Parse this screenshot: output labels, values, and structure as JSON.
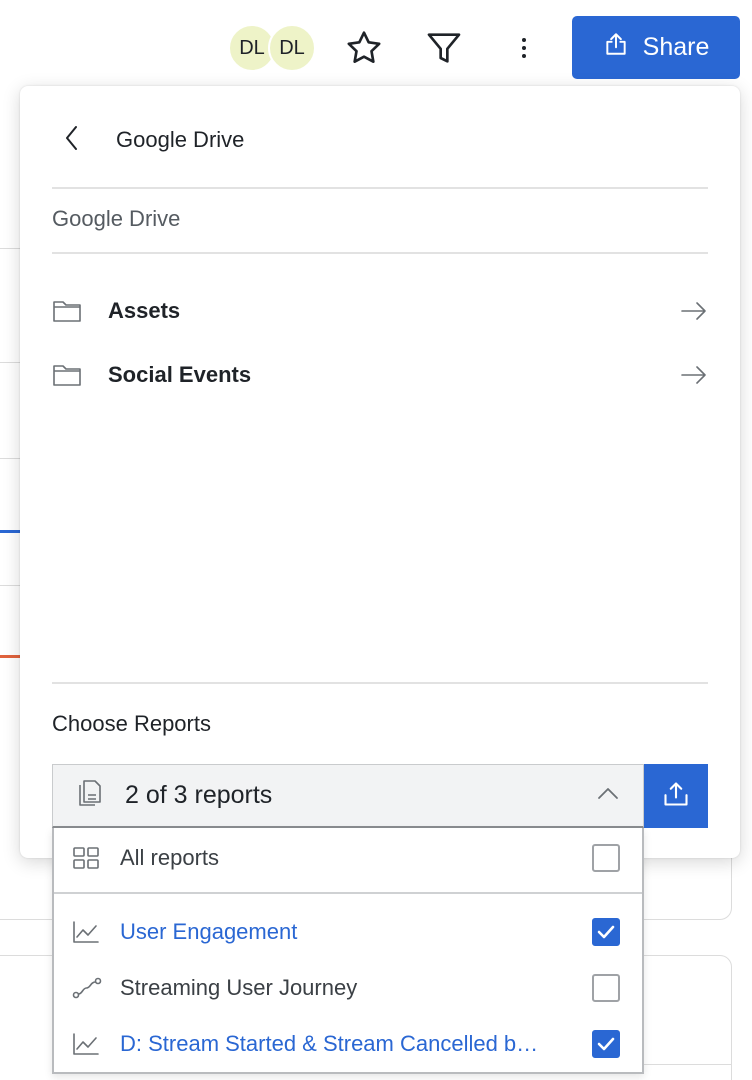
{
  "colors": {
    "accent": "#2a67d3",
    "avatar_bg": "#eef3c8",
    "chart_line_blue": "#2a67d3",
    "chart_line_orange": "#e0623d"
  },
  "toolbar": {
    "avatars": [
      "DL",
      "DL"
    ],
    "star_icon": "star-icon",
    "filter_icon": "filter-icon",
    "more_icon": "more-vertical-icon",
    "share_label": "Share",
    "share_icon": "share-upload-icon"
  },
  "popover": {
    "back_icon": "chevron-left-icon",
    "title": "Google Drive",
    "breadcrumb": "Google Drive",
    "folders": [
      {
        "name": "Assets",
        "icon": "folder-icon",
        "arrow_icon": "arrow-right-icon"
      },
      {
        "name": "Social Events",
        "icon": "folder-icon",
        "arrow_icon": "arrow-right-icon"
      }
    ],
    "choose_reports_label": "Choose Reports",
    "select": {
      "icon": "documents-icon",
      "value": "2 of 3 reports",
      "chevron_icon": "chevron-up-icon",
      "expanded": true
    },
    "export_icon": "upload-icon"
  },
  "dropdown": {
    "all": {
      "label": "All reports",
      "icon": "dashboard-grid-icon",
      "checked": false
    },
    "items": [
      {
        "label": "User Engagement",
        "icon": "line-chart-icon",
        "checked": true
      },
      {
        "label": "Streaming User Journey",
        "icon": "journey-icon",
        "checked": false
      },
      {
        "label": "D: Stream Started & Stream Cancelled b…",
        "icon": "line-chart-icon",
        "checked": true
      }
    ]
  }
}
